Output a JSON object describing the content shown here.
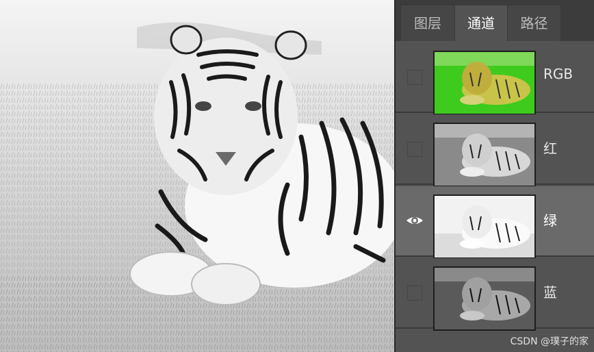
{
  "panel": {
    "tabs": [
      {
        "label": "图层",
        "active": false
      },
      {
        "label": "通道",
        "active": true
      },
      {
        "label": "路径",
        "active": false
      }
    ],
    "channels": [
      {
        "name": "RGB",
        "visible": false,
        "selected": false,
        "thumb_color": "#33cc1a"
      },
      {
        "name": "红",
        "visible": false,
        "selected": false,
        "thumb_color": "#9a9a9a"
      },
      {
        "name": "绿",
        "visible": true,
        "selected": true,
        "thumb_color": "#f4f4f4"
      },
      {
        "name": "蓝",
        "visible": false,
        "selected": false,
        "thumb_color": "#6e6e6e"
      }
    ]
  },
  "canvas": {
    "subject": "tiger lying on grass (green channel view)"
  },
  "watermark": "CSDN @璞子的家",
  "colors": {
    "panel_bg": "#535353",
    "selected_row": "#6a6a6a",
    "tab_bar": "#3c3c3c"
  }
}
